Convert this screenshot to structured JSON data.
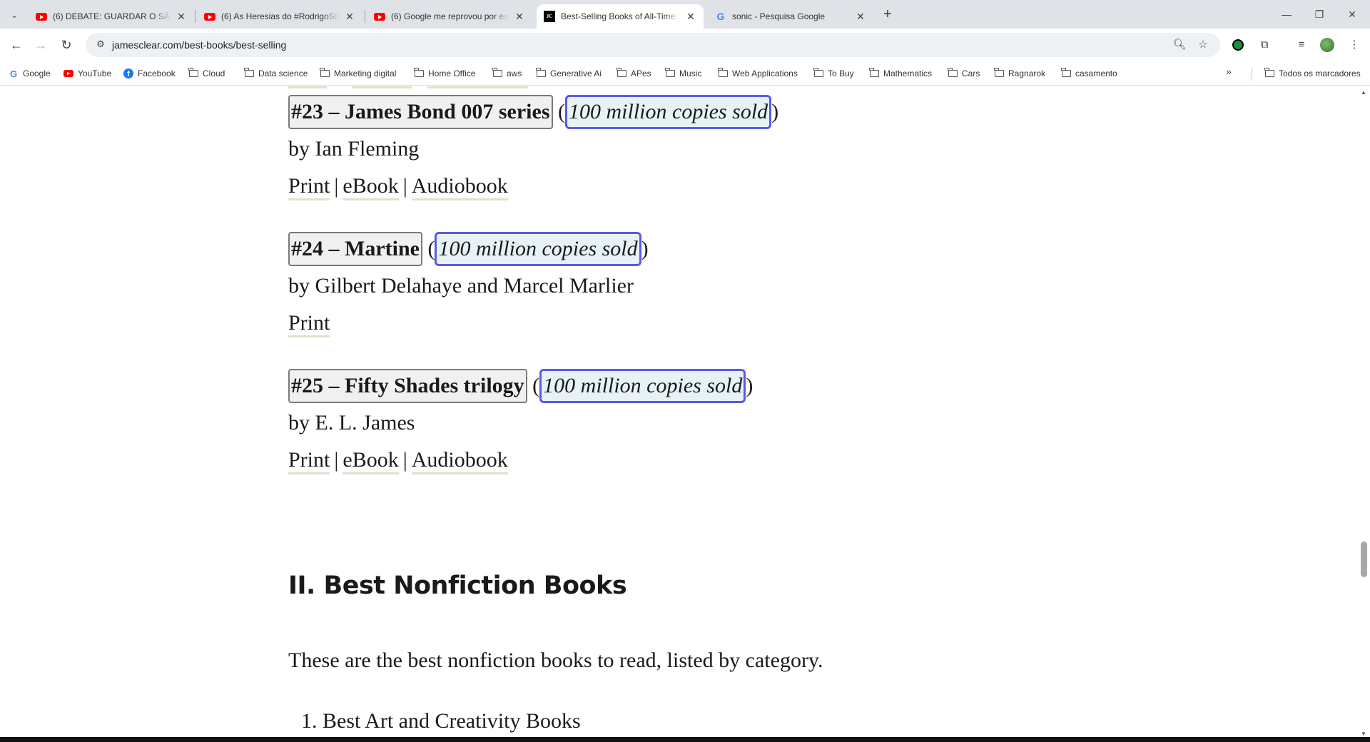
{
  "browser": {
    "tabs": [
      {
        "title": "(6) DEBATE: GUARDAR O SÁBADO",
        "favicon": "youtube-icon",
        "active": false
      },
      {
        "title": "(6) As Heresias do #RodrigoSilva",
        "favicon": "youtube-icon",
        "active": false
      },
      {
        "title": "(6) Google me reprovou por esse",
        "favicon": "youtube-icon",
        "active": false
      },
      {
        "title": "Best-Selling Books of All-Time:",
        "favicon": "jc-icon",
        "active": true
      },
      {
        "title": "sonic - Pesquisa Google",
        "favicon": "google-icon",
        "active": false
      }
    ],
    "jc_favicon_text": "JC",
    "google_favicon_text": "G",
    "url": "jamesclear.com/best-books/best-selling",
    "bookmarks": [
      {
        "label": "Google",
        "icon": "google-icon"
      },
      {
        "label": "YouTube",
        "icon": "youtube-icon"
      },
      {
        "label": "Facebook",
        "icon": "facebook-icon"
      },
      {
        "label": "Cloud",
        "icon": "folder-icon"
      },
      {
        "label": "Data science",
        "icon": "folder-icon"
      },
      {
        "label": "Marketing digital",
        "icon": "folder-icon"
      },
      {
        "label": "Home Office",
        "icon": "folder-icon"
      },
      {
        "label": "aws",
        "icon": "folder-icon"
      },
      {
        "label": "Generative Ai",
        "icon": "folder-icon"
      },
      {
        "label": "APes",
        "icon": "folder-icon"
      },
      {
        "label": "Music",
        "icon": "folder-icon"
      },
      {
        "label": "Web Applications",
        "icon": "folder-icon"
      },
      {
        "label": "To Buy",
        "icon": "folder-icon"
      },
      {
        "label": "Mathematics",
        "icon": "folder-icon"
      },
      {
        "label": "Cars",
        "icon": "folder-icon"
      },
      {
        "label": "Ragnarok",
        "icon": "folder-icon"
      },
      {
        "label": "casamento",
        "icon": "folder-icon"
      }
    ],
    "all_bookmarks_label": "Todos os marcadores"
  },
  "page": {
    "books": [
      {
        "rank_title": "#23 – James Bond 007 series",
        "sold": "100 million copies sold",
        "author": "by Ian Fleming",
        "formats": [
          "Print",
          "eBook",
          "Audiobook"
        ]
      },
      {
        "rank_title": "#24 – Martine",
        "sold": "100 million copies sold",
        "author": "by Gilbert Delahaye and Marcel Marlier",
        "formats": [
          "Print"
        ]
      },
      {
        "rank_title": "#25 – Fifty Shades trilogy",
        "sold": "100 million copies sold",
        "author": "by E. L. James",
        "formats": [
          "Print",
          "eBook",
          "Audiobook"
        ]
      }
    ],
    "section_heading": "II. Best Nonfiction Books",
    "section_intro": "These are the best nonfiction books to read, listed by category.",
    "list_first_item": "1. Best Art and Creativity Books"
  },
  "colors": {
    "rank_box_border": "#7a7a7a",
    "sold_box_border": "#5a5ae6",
    "sold_box_bg": "#e6f2f5",
    "link_underline": "#e3dfcc"
  }
}
